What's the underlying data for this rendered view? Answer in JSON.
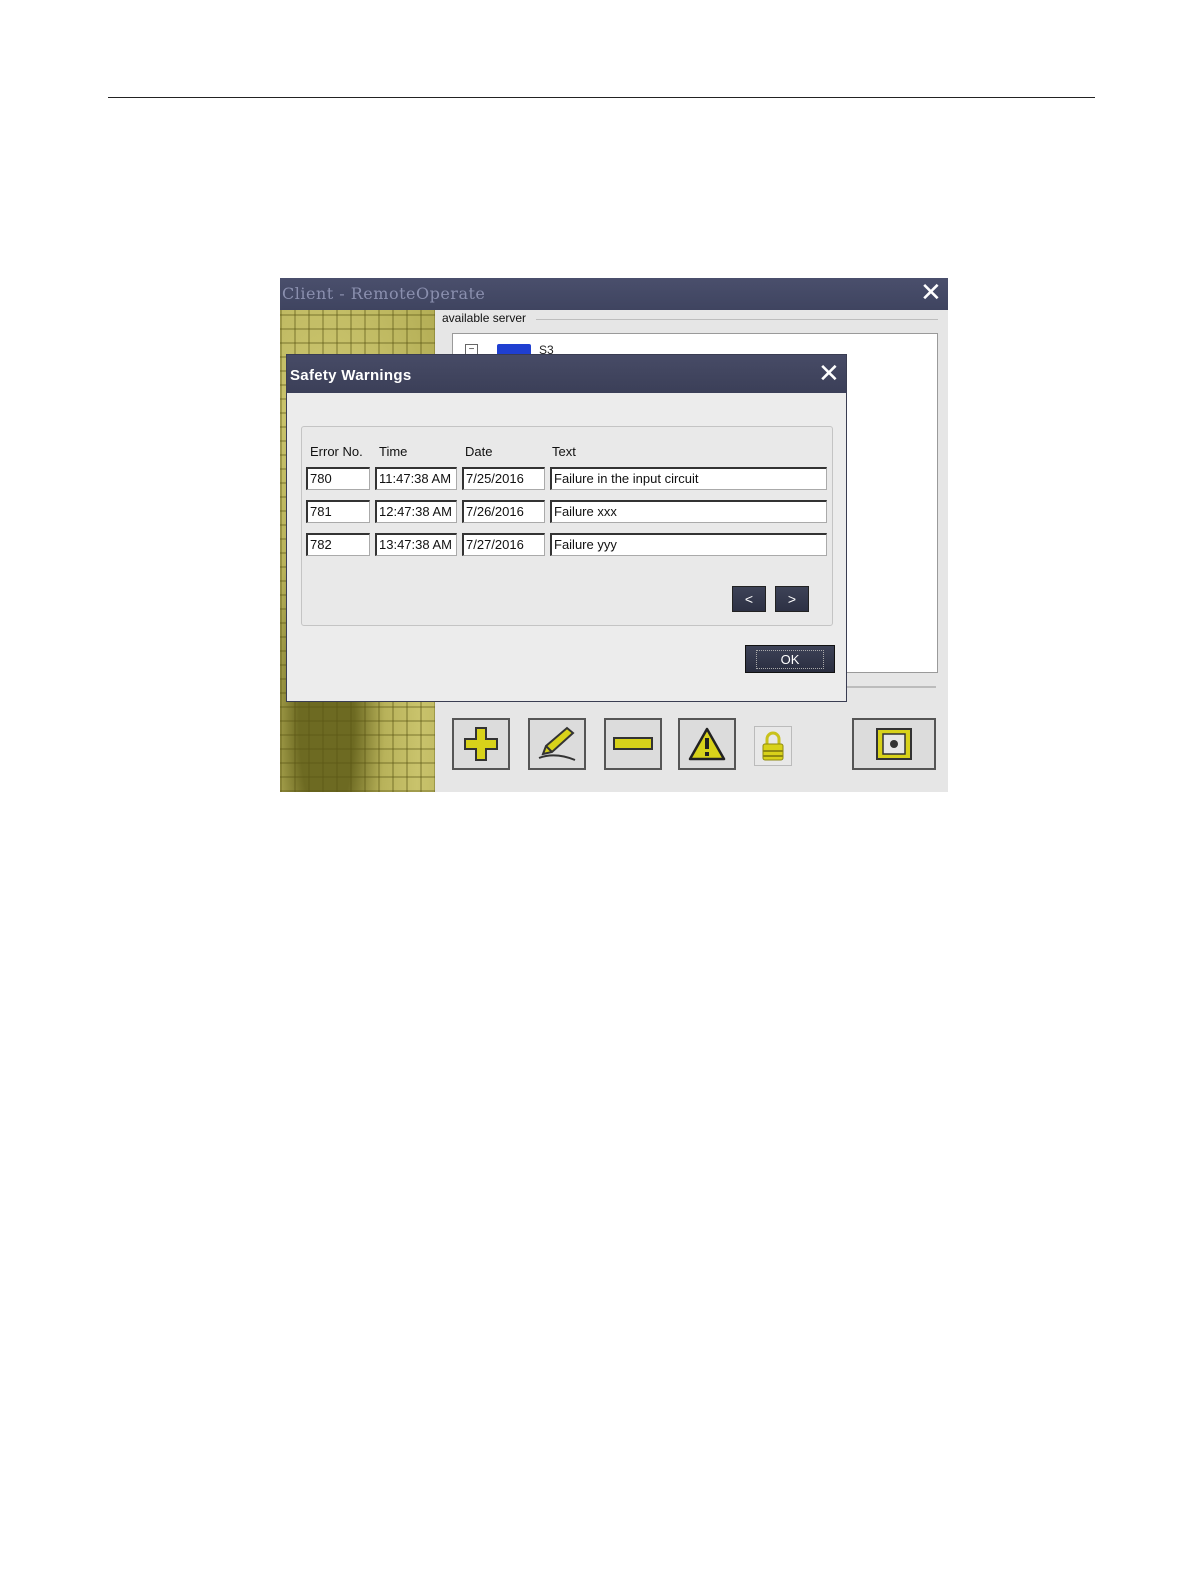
{
  "app": {
    "title": "Client - RemoteOperate",
    "server_group_label": "available server",
    "tree_item_label": "S3"
  },
  "dialog": {
    "title": "Safety Warnings",
    "columns": [
      "Error No.",
      "Time",
      "Date",
      "Text"
    ],
    "rows": [
      {
        "error_no": "780",
        "time": "11:47:38 AM",
        "date": "7/25/2016",
        "text": "Failure in the input circuit"
      },
      {
        "error_no": "781",
        "time": "12:47:38 AM",
        "date": "7/26/2016",
        "text": "Failure xxx"
      },
      {
        "error_no": "782",
        "time": "13:47:38 AM",
        "date": "7/27/2016",
        "text": "Failure yyy"
      }
    ],
    "prev_label": "<",
    "next_label": ">",
    "ok_label": "OK"
  },
  "toolbar_icons": [
    "plus-icon",
    "pencil-icon",
    "minus-icon",
    "warning-icon",
    "lock-icon",
    "target-icon"
  ],
  "colors": {
    "titlebar": "#3f4460",
    "icon_yellow": "#d8d21a",
    "art_olive": "#b8b25a"
  }
}
